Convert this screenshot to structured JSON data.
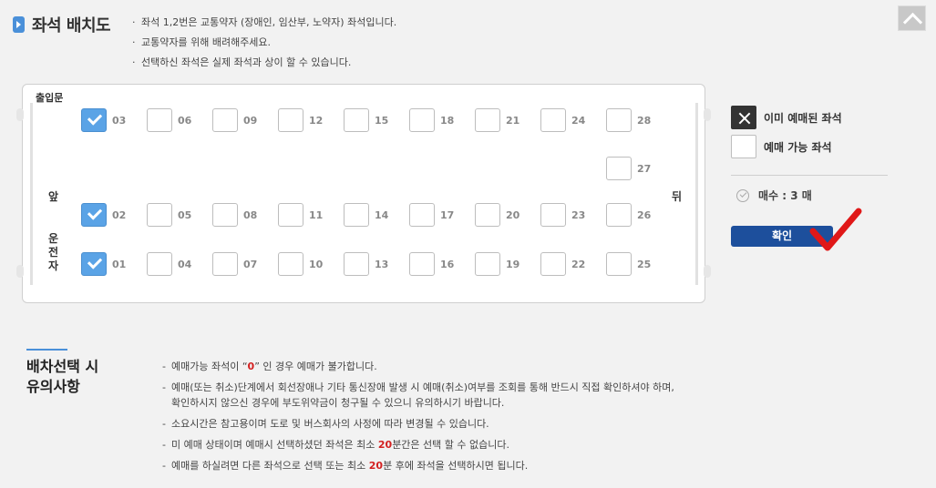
{
  "header": {
    "title": "좌석 배치도",
    "notices": [
      "좌석 1,2번은 교통약자 (장애인, 임산부, 노약자) 좌석입니다.",
      "교통약자를 위해 배려해주세요.",
      "선택하신 좌석은 실제 좌석과 상이 할 수 있습니다."
    ]
  },
  "bus": {
    "door_label": "출입문",
    "front_label": "앞",
    "driver_label": "운전자",
    "back_label": "뒤",
    "seats": [
      {
        "num": "03",
        "checked": true
      },
      {
        "num": "06",
        "checked": false
      },
      {
        "num": "09",
        "checked": false
      },
      {
        "num": "12",
        "checked": false
      },
      {
        "num": "15",
        "checked": false
      },
      {
        "num": "18",
        "checked": false
      },
      {
        "num": "21",
        "checked": false
      },
      {
        "num": "24",
        "checked": false
      },
      {
        "num": "28",
        "checked": false
      },
      {
        "num": "27",
        "checked": false
      },
      {
        "num": "02",
        "checked": true
      },
      {
        "num": "05",
        "checked": false
      },
      {
        "num": "08",
        "checked": false
      },
      {
        "num": "11",
        "checked": false
      },
      {
        "num": "14",
        "checked": false
      },
      {
        "num": "17",
        "checked": false
      },
      {
        "num": "20",
        "checked": false
      },
      {
        "num": "23",
        "checked": false
      },
      {
        "num": "26",
        "checked": false
      },
      {
        "num": "01",
        "checked": true
      },
      {
        "num": "04",
        "checked": false
      },
      {
        "num": "07",
        "checked": false
      },
      {
        "num": "10",
        "checked": false
      },
      {
        "num": "13",
        "checked": false
      },
      {
        "num": "16",
        "checked": false
      },
      {
        "num": "19",
        "checked": false
      },
      {
        "num": "22",
        "checked": false
      },
      {
        "num": "25",
        "checked": false
      }
    ]
  },
  "legend": {
    "booked_label": "이미 예매된 좌석",
    "available_label": "예매 가능 좌석",
    "count_text": "매수 : 3 매",
    "confirm_label": "확인"
  },
  "cautions": {
    "title_line1": "배차선택 시",
    "title_line2": "유의사항",
    "items": [
      {
        "pre": "예매가능 좌석이 “",
        "hl": "0",
        "post": "” 인 경우 예매가 불가합니다."
      },
      {
        "pre": "예매(또는 취소)단계에서 회선장애나 기타 통신장애 발생 시 예매(취소)여부를 조회를 통해 반드시 직접 확인하셔야 하며,",
        "line2": "확인하시지 않으신 경우에 부도위약금이 청구될 수 있으니 유의하시기 바랍니다."
      },
      {
        "pre": "소요시간은 참고용이며 도로 및 버스회사의 사정에 따라 변경될 수 있습니다."
      },
      {
        "pre": "미 예매 상태이며 예매시 선택하셨던 좌석은 최소 ",
        "hl": "20",
        "post": "분간은 선택 할 수 없습니다."
      },
      {
        "pre": "예매를 하실려면 다른 좌석으로 선택 또는 최소 ",
        "hl": "20",
        "post": "분 후에 좌석을 선택하시면 됩니다."
      }
    ]
  },
  "colors": {
    "accent": "#4a90d9",
    "checked_seat": "#5aa3e6",
    "confirm_button": "#1d4f9c",
    "highlight": "#d32020"
  },
  "icons": {
    "title": "play-arrow-icon",
    "top": "chevron-up-icon",
    "booked": "x-icon",
    "count": "check-circle-icon",
    "annotation": "red-checkmark-icon"
  }
}
